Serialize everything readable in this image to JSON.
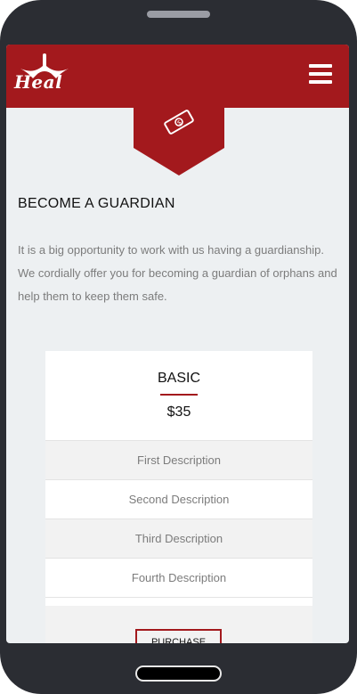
{
  "app": {
    "logo_text": "Heal"
  },
  "colors": {
    "brand": "#a3191d",
    "background": "#edf0f2",
    "text_muted": "#7c7c7c"
  },
  "header": {
    "menu_icon": "hamburger-menu-icon",
    "badge_icon": "money-bill-icon"
  },
  "section": {
    "title": "BECOME A GUARDIAN",
    "body": "It is a big opportunity to work with us having a guardianship. We cordially offer you for becoming a guardian of orphans and help them to keep them safe."
  },
  "plan": {
    "name": "BASIC",
    "price": "$35",
    "features": [
      "First Description",
      "Second Description",
      "Third Description",
      "Fourth Description"
    ],
    "button_label": "PURCHASE"
  }
}
